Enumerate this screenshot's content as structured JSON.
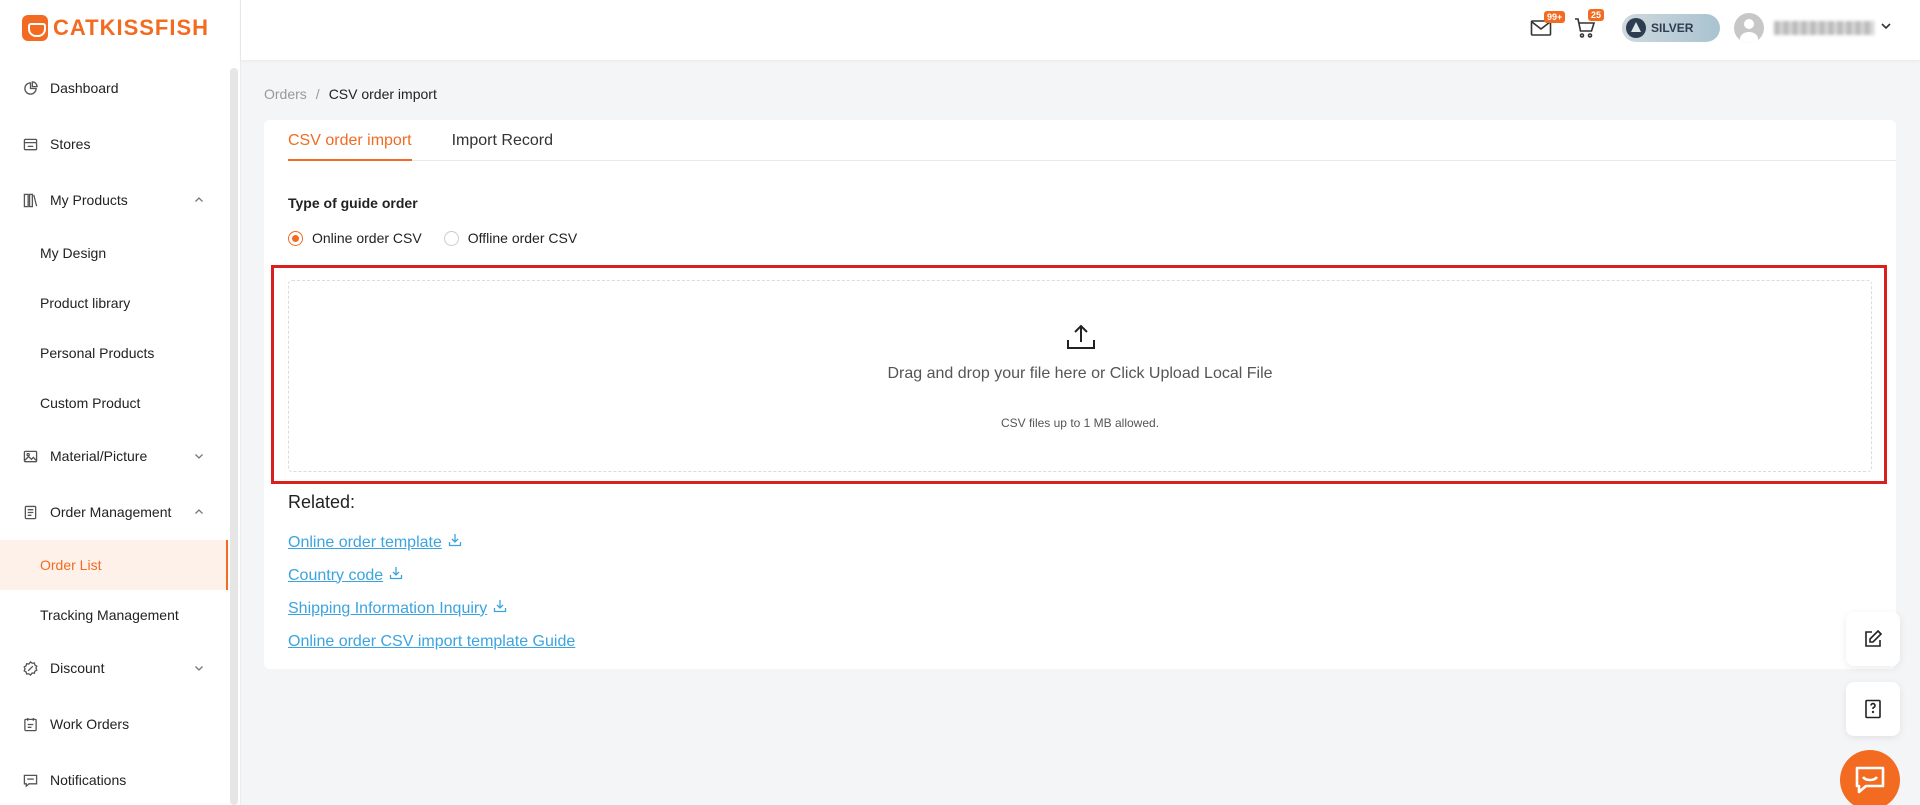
{
  "brand": {
    "name": "CATKISSFISH",
    "color": "#f26b21"
  },
  "sidebar": {
    "items": [
      {
        "label": "Dashboard",
        "icon": "pie-chart-icon"
      },
      {
        "label": "Stores",
        "icon": "store-icon"
      },
      {
        "label": "My Products",
        "icon": "products-icon",
        "expanded": true,
        "children": [
          "My Design",
          "Product library",
          "Personal Products",
          "Custom Product"
        ]
      },
      {
        "label": "Material/Picture",
        "icon": "image-icon",
        "expanded": false
      },
      {
        "label": "Order Management",
        "icon": "clipboard-icon",
        "expanded": true,
        "children": [
          "Order List",
          "Tracking Management"
        ],
        "active_child": "Order List"
      },
      {
        "label": "Discount",
        "icon": "discount-icon",
        "expanded": false
      },
      {
        "label": "Work Orders",
        "icon": "calendar-icon"
      },
      {
        "label": "Notifications",
        "icon": "message-icon"
      }
    ]
  },
  "header": {
    "mail_badge": "99+",
    "cart_badge": "25",
    "level": "SILVER"
  },
  "breadcrumb": {
    "parent": "Orders",
    "separator": "/",
    "current": "CSV order import"
  },
  "tabs": [
    {
      "label": "CSV order import",
      "active": true
    },
    {
      "label": "Import Record",
      "active": false
    }
  ],
  "form": {
    "type_label": "Type of guide order",
    "options": [
      {
        "label": "Online order CSV",
        "selected": true
      },
      {
        "label": "Offline order CSV",
        "selected": false
      }
    ]
  },
  "upload": {
    "main_text": "Drag and drop your file here or Click Upload Local File",
    "hint_text": "CSV files up to 1 MB allowed."
  },
  "related": {
    "title": "Related:",
    "links": [
      {
        "label": "Online order template",
        "download": true
      },
      {
        "label": "Country code",
        "download": true
      },
      {
        "label": "Shipping Information Inquiry",
        "download": true
      },
      {
        "label": "Online order CSV import template Guide",
        "download": false
      }
    ]
  }
}
